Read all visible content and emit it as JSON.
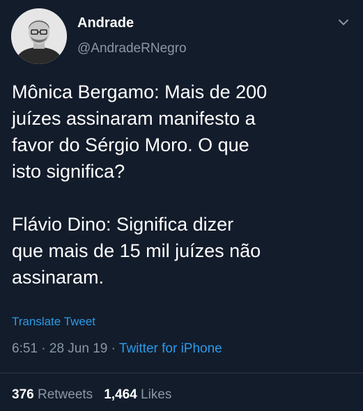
{
  "author": {
    "name": "Andrade",
    "handle": "@AndradeRNegro",
    "avatar_icon": "profile-photo"
  },
  "tweet": {
    "paragraphs": [
      "Mônica Bergamo: Mais de 200\njuízes assinaram manifesto a\nfavor do Sérgio Moro. O que\nisto significa?",
      "Flávio Dino: Significa dizer\nque mais de 15 mil juízes não\nassinaram."
    ],
    "translate_label": "Translate Tweet",
    "time": "6:51",
    "date": "28 Jun 19",
    "separator": " · ",
    "source": "Twitter for iPhone"
  },
  "stats": {
    "retweets_count": "376",
    "retweets_label": "Retweets",
    "likes_count": "1,464",
    "likes_label": "Likes"
  },
  "colors": {
    "background": "#131c2b",
    "secondary_text": "#8a97a6",
    "link": "#2a9be9"
  }
}
